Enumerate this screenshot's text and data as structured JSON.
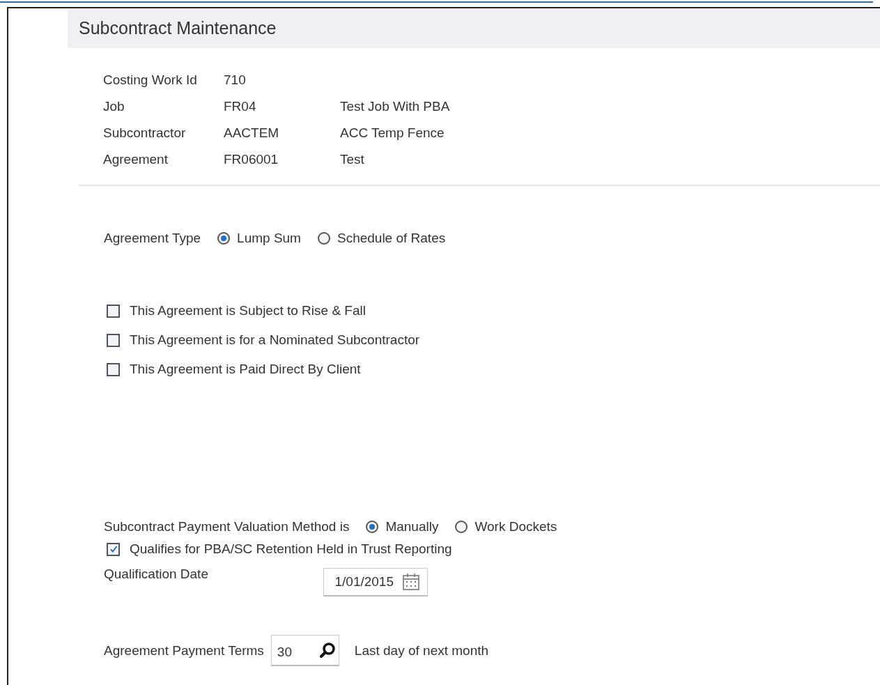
{
  "title": "Subcontract Maintenance",
  "details": [
    {
      "label": "Costing Work Id",
      "value": "710"
    },
    {
      "label": "Job",
      "value": "FR04",
      "description": "Test Job With PBA"
    },
    {
      "label": "Subcontractor",
      "value": "AACTEM",
      "description": "ACC Temp Fence"
    },
    {
      "label": "Agreement",
      "value": "FR06001",
      "description": "Test"
    }
  ],
  "agreement_type": {
    "label": "Agreement Type",
    "options": [
      {
        "label": "Lump Sum",
        "selected": true
      },
      {
        "label": "Schedule of Rates",
        "selected": false
      }
    ]
  },
  "flags": [
    {
      "label": "This Agreement is Subject to Rise & Fall",
      "checked": false
    },
    {
      "label": "This Agreement is for a Nominated Subcontractor",
      "checked": false
    },
    {
      "label": "This Agreement is Paid Direct By Client",
      "checked": false
    }
  ],
  "valuation_method": {
    "label": "Subcontract Payment Valuation Method is",
    "options": [
      {
        "label": "Manually",
        "selected": true
      },
      {
        "label": "Work Dockets",
        "selected": false
      }
    ]
  },
  "trust_reporting": {
    "label": "Qualifies for PBA/SC Retention Held in Trust Reporting",
    "checked": true
  },
  "qualification_date": {
    "label": "Qualification Date",
    "value": "1/01/2015"
  },
  "payment_terms": {
    "label": "Agreement Payment Terms",
    "value": "30",
    "description": "Last day of next month"
  }
}
